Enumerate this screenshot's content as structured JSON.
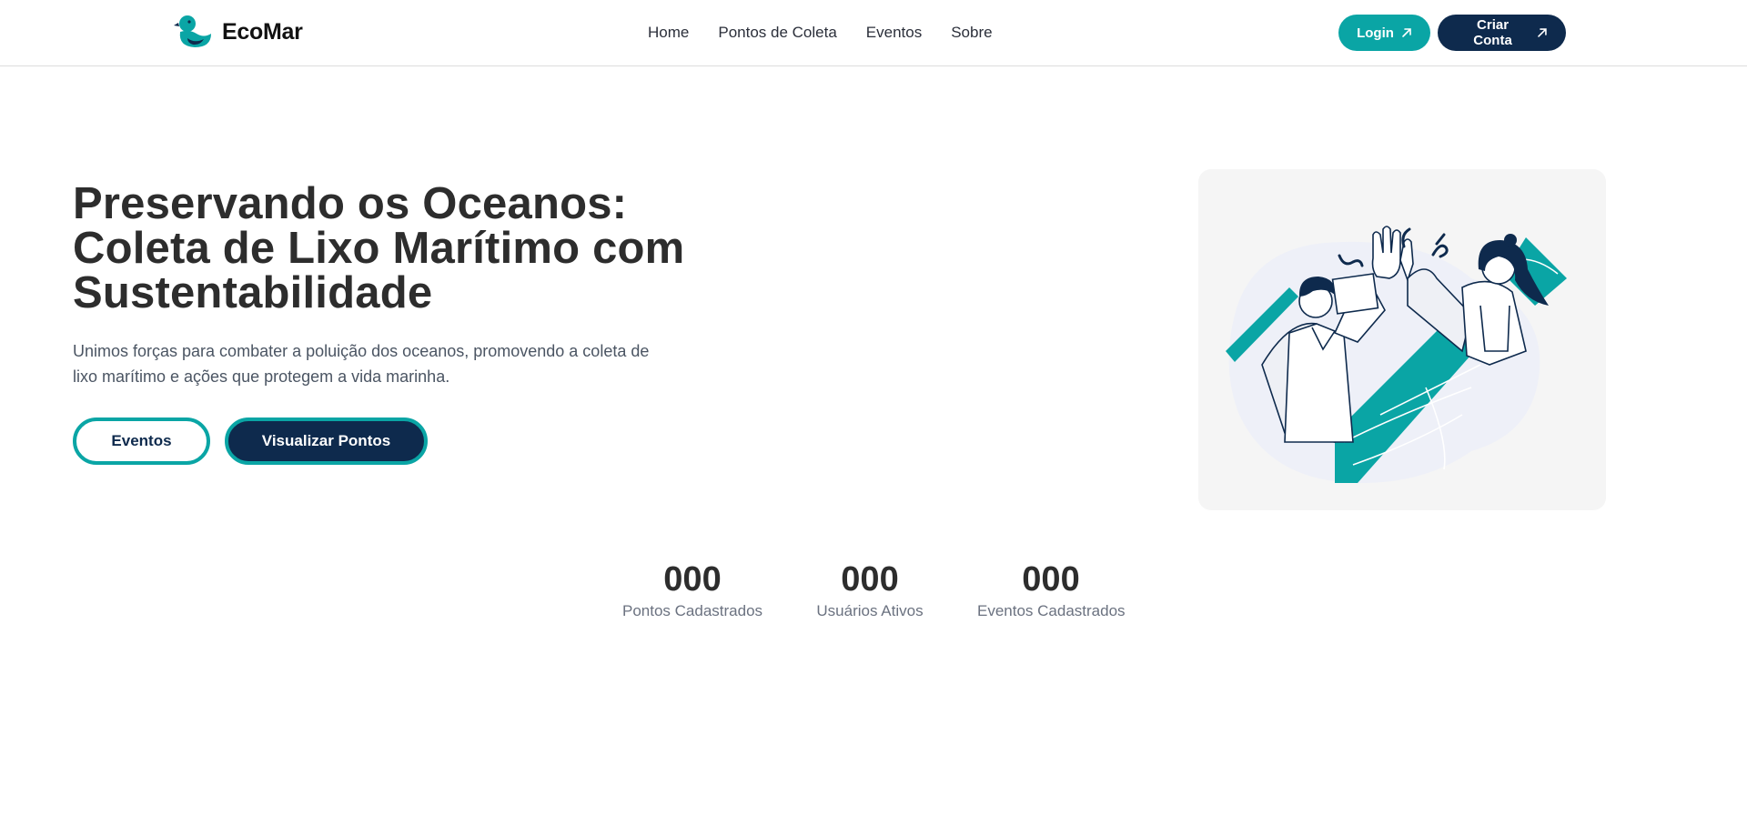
{
  "header": {
    "brand": "EcoMar",
    "nav": [
      "Home",
      "Pontos de Coleta",
      "Eventos",
      "Sobre"
    ],
    "login_label": "Login",
    "signup_label": "Criar Conta"
  },
  "hero": {
    "title_line1": "Preservando os Oceanos:",
    "title_line2": "Coleta de Lixo Marítimo com",
    "title_line3": "Sustentabilidade",
    "description_line1": "Unimos forças para combater a poluição dos oceanos, promovendo a coleta de",
    "description_line2": "lixo marítimo e ações que protegem a vida marinha.",
    "events_button": "Eventos",
    "points_button": "Visualizar Pontos"
  },
  "stats": [
    {
      "value": "000",
      "label": "Pontos Cadastrados"
    },
    {
      "value": "000",
      "label": "Usuários Ativos"
    },
    {
      "value": "000",
      "label": "Eventos Cadastrados"
    }
  ],
  "icons": {
    "logo": "duck-icon",
    "login_arrow": "arrow-up-right-icon",
    "signup_arrow": "arrow-up-right-icon"
  },
  "colors": {
    "accent": "#0aa5a5",
    "navy": "#0e2a4d",
    "text": "#2d2d2d",
    "muted": "#6b7280",
    "card": "#f5f5f5"
  }
}
